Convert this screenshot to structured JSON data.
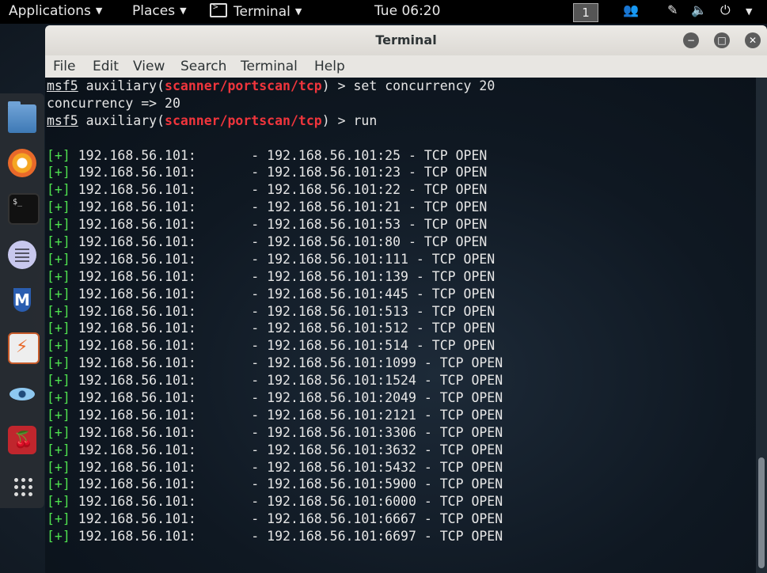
{
  "top_panel": {
    "applications": "Applications",
    "places": "Places",
    "terminal": "Terminal",
    "clock": "Tue 06:20",
    "workspace": "1"
  },
  "window": {
    "title": "Terminal",
    "menu": [
      "File",
      "Edit",
      "View",
      "Search",
      "Terminal",
      "Help"
    ]
  },
  "terminal": {
    "prompt_prefix": "msf5",
    "prompt_module_word": " auxiliary(",
    "module": "scanner/portscan/tcp",
    "prompt_suffix": ") > ",
    "cmd1": "set concurrency 20",
    "output1": "concurrency => 20",
    "cmd2": "run",
    "result_tag": "[+]",
    "host": "192.168.56.101",
    "results": [
      " 192.168.56.101:       - 192.168.56.101:25 - TCP OPEN",
      " 192.168.56.101:       - 192.168.56.101:23 - TCP OPEN",
      " 192.168.56.101:       - 192.168.56.101:22 - TCP OPEN",
      " 192.168.56.101:       - 192.168.56.101:21 - TCP OPEN",
      " 192.168.56.101:       - 192.168.56.101:53 - TCP OPEN",
      " 192.168.56.101:       - 192.168.56.101:80 - TCP OPEN",
      " 192.168.56.101:       - 192.168.56.101:111 - TCP OPEN",
      " 192.168.56.101:       - 192.168.56.101:139 - TCP OPEN",
      " 192.168.56.101:       - 192.168.56.101:445 - TCP OPEN",
      " 192.168.56.101:       - 192.168.56.101:513 - TCP OPEN",
      " 192.168.56.101:       - 192.168.56.101:512 - TCP OPEN",
      " 192.168.56.101:       - 192.168.56.101:514 - TCP OPEN",
      " 192.168.56.101:       - 192.168.56.101:1099 - TCP OPEN",
      " 192.168.56.101:       - 192.168.56.101:1524 - TCP OPEN",
      " 192.168.56.101:       - 192.168.56.101:2049 - TCP OPEN",
      " 192.168.56.101:       - 192.168.56.101:2121 - TCP OPEN",
      " 192.168.56.101:       - 192.168.56.101:3306 - TCP OPEN",
      " 192.168.56.101:       - 192.168.56.101:3632 - TCP OPEN",
      " 192.168.56.101:       - 192.168.56.101:5432 - TCP OPEN",
      " 192.168.56.101:       - 192.168.56.101:5900 - TCP OPEN",
      " 192.168.56.101:       - 192.168.56.101:6000 - TCP OPEN",
      " 192.168.56.101:       - 192.168.56.101:6667 - TCP OPEN",
      " 192.168.56.101:       - 192.168.56.101:6697 - TCP OPEN"
    ]
  },
  "dock": {
    "icons": [
      "files-icon",
      "firefox-icon",
      "terminal-icon",
      "notes-icon",
      "maltego-icon",
      "burpsuite-icon",
      "eye-icon",
      "cherrytree-icon",
      "app-grid-icon"
    ]
  },
  "colors": {
    "module_red": "#f0353c",
    "plus_green": "#4fe14f",
    "terminal_bg": "#0f1822"
  }
}
